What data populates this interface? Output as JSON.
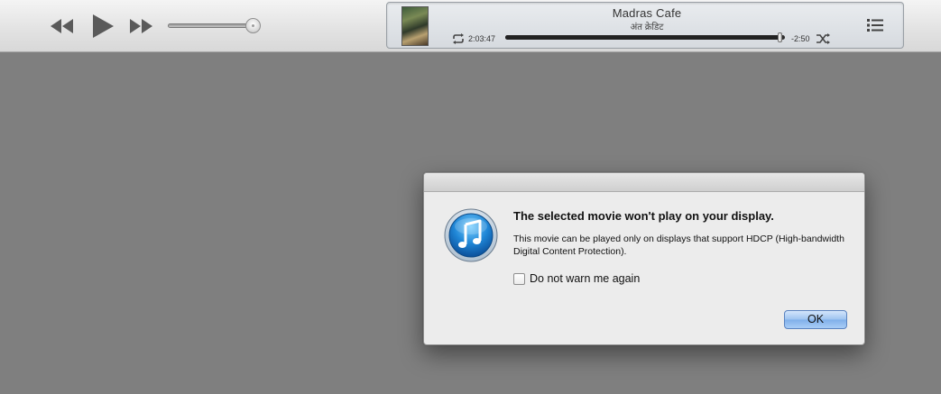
{
  "player": {
    "controls": {
      "rewind_icon": "rewind-icon",
      "play_icon": "play-icon",
      "fast_forward_icon": "fast-forward-icon"
    },
    "volume": {
      "level": 0.94
    },
    "now_playing": {
      "title": "Madras Cafe",
      "subtitle": "अंत क्रेडिट",
      "elapsed": "2:03:47",
      "remaining": "-2:50",
      "progress": 0.98,
      "repeat_icon": "repeat-icon",
      "shuffle_icon": "shuffle-icon",
      "artwork_icon": "album-artwork"
    },
    "list_icon": "list-view-icon"
  },
  "dialog": {
    "heading": "The selected movie won't play on your display.",
    "message": "This movie can be played only on displays that support HDCP (High-bandwidth Digital Content Protection).",
    "checkbox_label": "Do not warn me again",
    "checkbox_checked": false,
    "ok_label": "OK",
    "icon": "itunes-icon",
    "accent_color": "#7fafea"
  }
}
